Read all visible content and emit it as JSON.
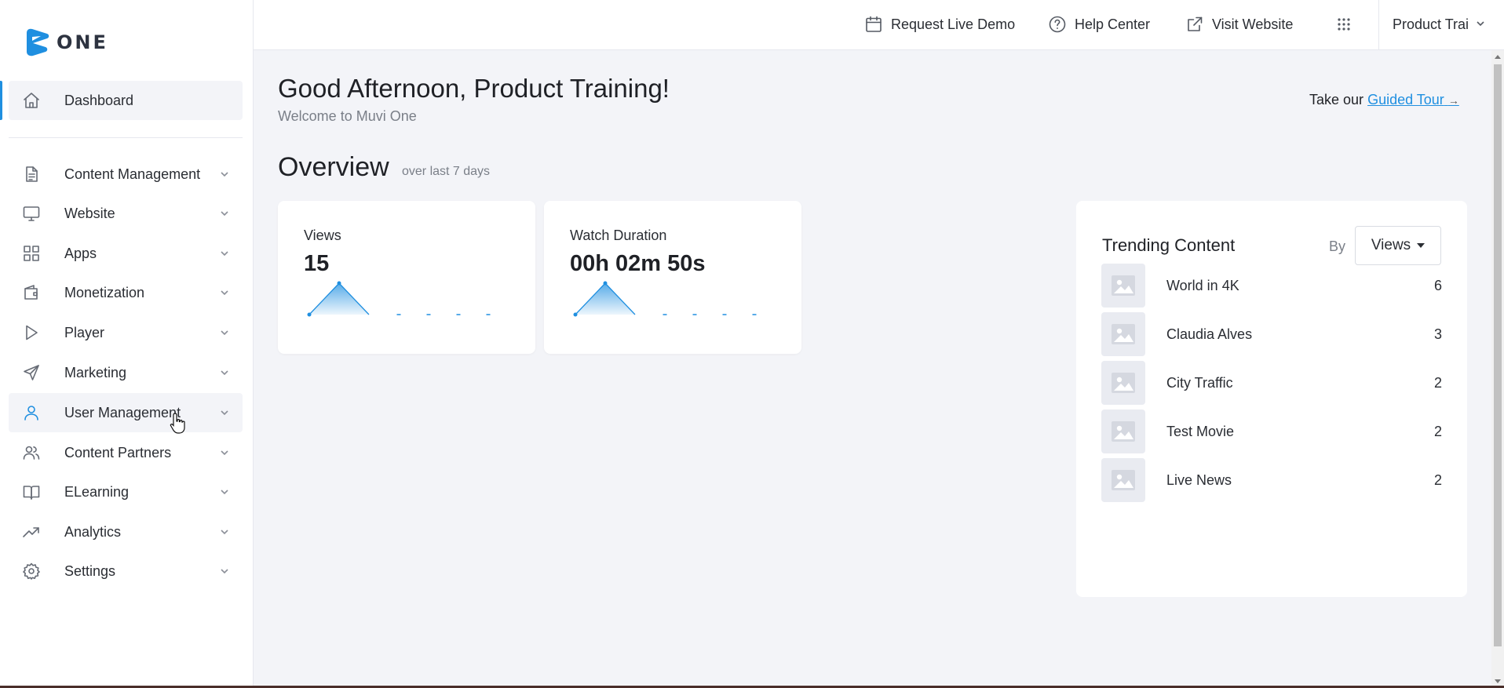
{
  "brand": {
    "logo_text": "ONE",
    "accent": "#1f8fe0"
  },
  "sidebar": {
    "items": [
      {
        "label": "Dashboard",
        "icon": "home-icon"
      },
      {
        "label": "Content Management",
        "icon": "document-icon"
      },
      {
        "label": "Website",
        "icon": "monitor-icon"
      },
      {
        "label": "Apps",
        "icon": "grid-icon"
      },
      {
        "label": "Monetization",
        "icon": "wallet-icon"
      },
      {
        "label": "Player",
        "icon": "play-icon"
      },
      {
        "label": "Marketing",
        "icon": "send-icon"
      },
      {
        "label": "User Management",
        "icon": "user-icon"
      },
      {
        "label": "Content Partners",
        "icon": "users-icon"
      },
      {
        "label": "ELearning",
        "icon": "book-icon"
      },
      {
        "label": "Analytics",
        "icon": "trending-up-icon"
      },
      {
        "label": "Settings",
        "icon": "gear-icon"
      }
    ]
  },
  "topbar": {
    "demo_label": "Request Live Demo",
    "help_label": "Help Center",
    "visit_label": "Visit Website",
    "user_label": "Product Trai"
  },
  "main": {
    "greeting": "Good Afternoon, Product Training!",
    "welcome": "Welcome to Muvi One",
    "tour_prefix": "Take our",
    "tour_link": "Guided Tour",
    "overview_title": "Overview",
    "overview_sub": "over last 7 days"
  },
  "cards": [
    {
      "title": "Views",
      "value": "15",
      "series": [
        0,
        1,
        0,
        0,
        0,
        0,
        0
      ]
    },
    {
      "title": "Watch Duration",
      "value": "00h 02m 50s",
      "series": [
        0,
        1,
        0,
        0,
        0,
        0,
        0
      ]
    }
  ],
  "trending": {
    "title": "Trending Content",
    "by_label": "By",
    "selected": "Views",
    "items": [
      {
        "name": "World in 4K",
        "count": "6"
      },
      {
        "name": "Claudia Alves",
        "count": "3"
      },
      {
        "name": "City Traffic",
        "count": "2"
      },
      {
        "name": "Test Movie",
        "count": "2"
      },
      {
        "name": "Live News",
        "count": "2"
      }
    ]
  }
}
